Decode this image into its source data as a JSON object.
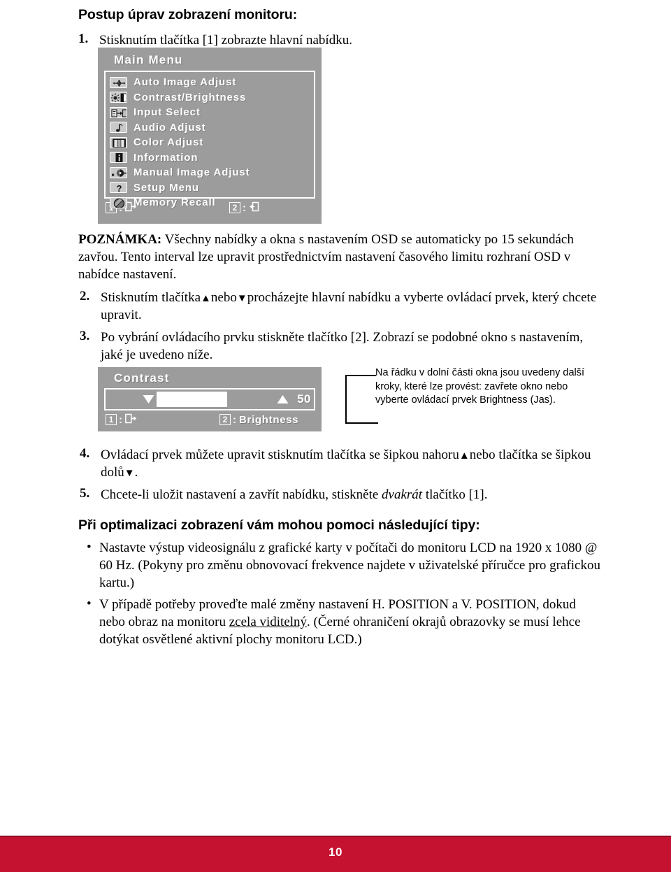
{
  "heading": "Postup úprav zobrazení monitoru:",
  "steps": [
    {
      "num": "1.",
      "text": "Stisknutím tlačítka [1] zobrazte hlavní nabídku."
    }
  ],
  "note": {
    "label": "POZNÁMKA:",
    "text": " Všechny nabídky a okna s nastavením OSD se automaticky po 15 sekundách zavřou. Tento interval lze upravit prostřednictvím nastavení časového limitu rozhraní OSD v nabídce nastavení."
  },
  "step2": {
    "num": "2.",
    "part1": "Stisknutím tlačítka",
    "up": "▲",
    "part2": "nebo",
    "down": "▼",
    "part3": "procházejte hlavní nabídku a vyberte ovládací prvek, který chcete upravit."
  },
  "step3": {
    "num": "3.",
    "text": "Po vybrání ovládacího prvku stiskněte tlačítko [2]. Zobrazí se podobné okno s nastavením, jaké je uvedeno níže."
  },
  "step4": {
    "num": "4.",
    "part1": "Ovládací prvek můžete upravit stisknutím tlačítka se šipkou nahoru",
    "up": "▲",
    "part2": "nebo tlačítka se šipkou dolů",
    "down": "▼",
    "part3": "."
  },
  "step5": {
    "num": "5.",
    "part1": "Chcete-li uložit nastavení a zavřít nabídku, stiskněte ",
    "emph": "dvakrát",
    "part2": " tlačítko [1]."
  },
  "tips_heading": "Při optimalizaci zobrazení vám mohou pomoci následující tipy:",
  "tips": [
    {
      "text": "Nastavte výstup videosignálu z grafické karty v počítači do monitoru LCD na 1920 x 1080 @ 60 Hz. (Pokyny pro změnu obnovovací frekvence najdete v uživatelské příručce pro grafickou kartu.)"
    }
  ],
  "tip2": {
    "part1": "V případě potřeby proveďte malé změny nastavení H. POSITION a V. POSITION, dokud nebo obraz na monitoru ",
    "underline": "zcela viditelný",
    "part2": ". (Černé ohraničení okrajů obrazovky se musí lehce dotýkat osvětlené aktivní plochy monitoru LCD.)"
  },
  "osd_main": {
    "title": "Main Menu",
    "items": [
      {
        "label": "Auto Image Adjust",
        "icon": "auto-image-adjust-icon"
      },
      {
        "label": "Contrast/Brightness",
        "icon": "contrast-brightness-icon"
      },
      {
        "label": "Input Select",
        "icon": "input-select-icon"
      },
      {
        "label": "Audio Adjust",
        "icon": "audio-adjust-icon"
      },
      {
        "label": "Color Adjust",
        "icon": "color-adjust-icon"
      },
      {
        "label": "Information",
        "icon": "information-icon"
      },
      {
        "label": "Manual Image Adjust",
        "icon": "manual-image-adjust-icon"
      },
      {
        "label": "Setup Menu",
        "icon": "setup-menu-icon"
      },
      {
        "label": "Memory Recall",
        "icon": "memory-recall-icon"
      }
    ],
    "bar": {
      "key1": "1",
      "colon1": ":",
      "key2": "2",
      "colon2": ":",
      "action1_icon": "exit-icon",
      "action2_icon": "enter-icon"
    }
  },
  "osd_contrast": {
    "title": "Contrast",
    "value": "50",
    "fill_percent": 60,
    "down_arrow": "▼",
    "up_arrow": "▲",
    "bar": {
      "key1": "1",
      "colon1": ":",
      "action1_icon": "exit-icon",
      "key2": "2",
      "colon2": ":",
      "action2_label": "Brightness"
    }
  },
  "callout": {
    "text": "Na řádku v dolní části okna jsou uvedeny další kroky, které lze provést: zavřete okno nebo vyberte ovládací prvek Brightness (Jas)."
  },
  "footer": {
    "page_number": "10",
    "accent_color": "#c41230"
  }
}
